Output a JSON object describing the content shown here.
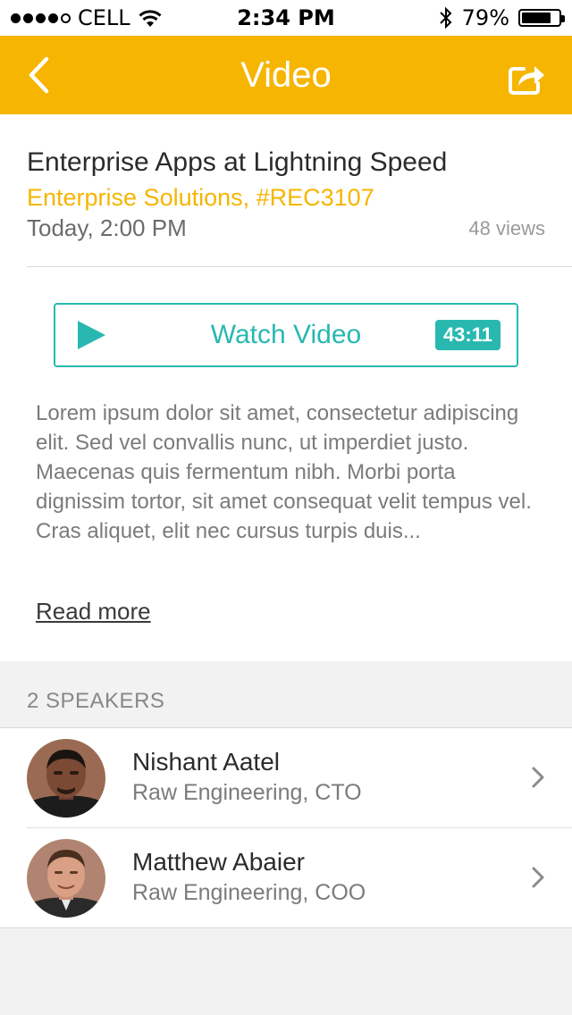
{
  "status_bar": {
    "carrier": "CELL",
    "time": "2:34 PM",
    "battery_percent": "79%",
    "battery_level": 0.79,
    "icons": [
      "signal-dots-icon",
      "wifi-icon",
      "bluetooth-icon",
      "battery-icon"
    ]
  },
  "navbar": {
    "title": "Video",
    "back_icon": "chevron-left-icon",
    "share_icon": "share-icon",
    "background": "#f6b500"
  },
  "session": {
    "title": "Enterprise Apps at Lightning Speed",
    "track": "Enterprise Solutions, #REC3107",
    "datetime": "Today, 2:00 PM",
    "views": "48 views"
  },
  "video": {
    "watch_label": "Watch Video",
    "duration": "43:11",
    "accent": "#28b8b0",
    "icon": "play-icon"
  },
  "description": {
    "text": "Lorem ipsum dolor sit amet, consectetur adipiscing elit. Sed vel convallis nunc, ut imperdiet justo. Maecenas quis fermentum nibh. Morbi porta dignissim tortor, sit amet consequat velit tempus vel. Cras aliquet, elit nec cursus turpis duis...",
    "read_more": "Read more"
  },
  "speakers": {
    "header": "2 SPEAKERS",
    "items": [
      {
        "name": "Nishant Aatel",
        "role": "Raw Engineering, CTO"
      },
      {
        "name": "Matthew Abaier",
        "role": "Raw Engineering, COO"
      }
    ]
  }
}
